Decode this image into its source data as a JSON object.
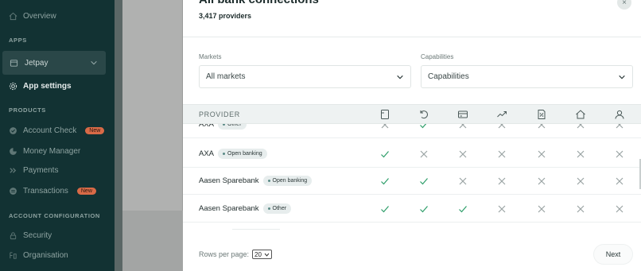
{
  "sidebar": {
    "overview": "Overview",
    "apps_section": "APPS",
    "app_name": "Jetpay",
    "app_settings": "App settings",
    "products_section": "PRODUCTS",
    "products": [
      {
        "label": "Account Check",
        "badge": "New"
      },
      {
        "label": "Money Manager",
        "badge": ""
      },
      {
        "label": "Payments",
        "badge": ""
      },
      {
        "label": "Transactions",
        "badge": "New"
      }
    ],
    "account_section": "ACCOUNT CONFIGURATION",
    "security": "Security",
    "organisation": "Organisation"
  },
  "modal": {
    "title": "All bank connections",
    "subtitle": "3,417 providers",
    "close": "×",
    "filters": {
      "markets_label": "Markets",
      "markets_value": "All markets",
      "capabilities_label": "Capabilities",
      "capabilities_value": "Capabilities"
    },
    "table": {
      "provider_header": "PROVIDER",
      "capability_icons": [
        "account-icon",
        "refresh-icon",
        "card-icon",
        "trend-icon",
        "percent-doc-icon",
        "home-icon",
        "person-icon"
      ],
      "rows": [
        {
          "name": "AXA",
          "tag": "Other",
          "caps": [
            "x",
            "check",
            "x",
            "x",
            "x",
            "x",
            "x"
          ]
        },
        {
          "name": "AXA",
          "tag": "Open banking",
          "caps": [
            "check",
            "x",
            "x",
            "x",
            "x",
            "x",
            "x"
          ]
        },
        {
          "name": "Aasen Sparebank",
          "tag": "Open banking",
          "caps": [
            "check",
            "check",
            "x",
            "x",
            "x",
            "x",
            "x"
          ]
        },
        {
          "name": "Aasen Sparebank",
          "tag": "Other",
          "caps": [
            "check",
            "check",
            "check",
            "x",
            "x",
            "x",
            "x"
          ]
        }
      ]
    },
    "footer": {
      "rows_per_page_label": "Rows per page:",
      "rows_per_page_value": "20",
      "next": "Next"
    }
  },
  "colors": {
    "sidebar_bg": "#123233",
    "check": "#2e9e6a",
    "cross": "#9aa3a3",
    "badge_new": "#d86a47"
  }
}
